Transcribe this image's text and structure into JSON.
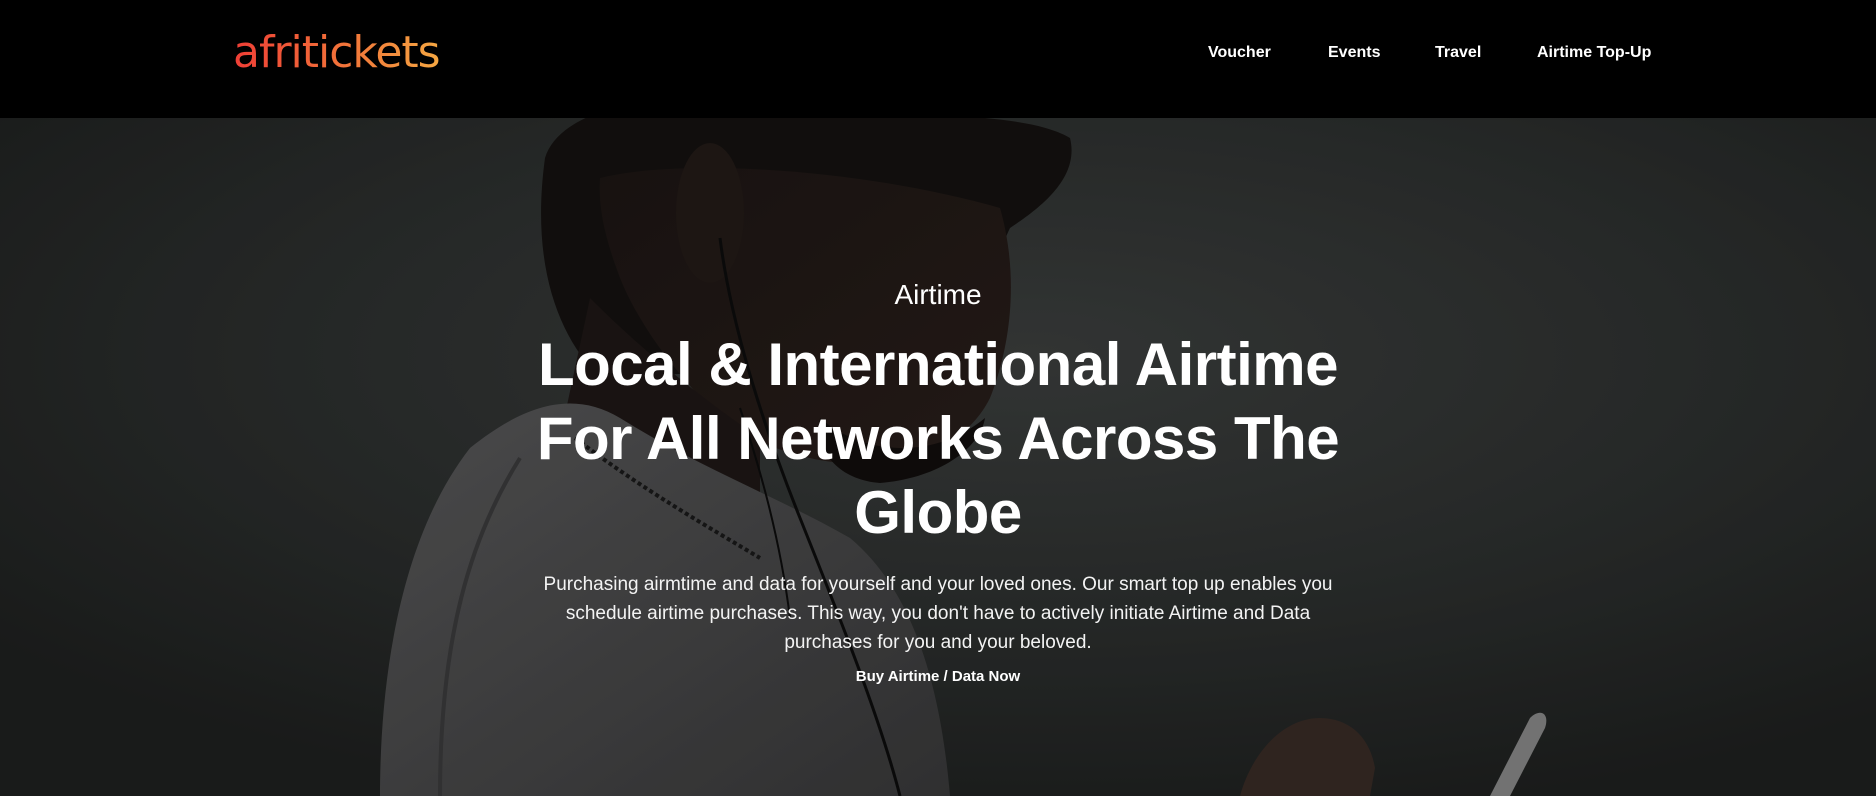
{
  "header": {
    "logo_text": "afritickets",
    "nav": [
      {
        "label": "Voucher"
      },
      {
        "label": "Events"
      },
      {
        "label": "Travel"
      },
      {
        "label": "Airtime Top-Up"
      }
    ]
  },
  "hero": {
    "eyebrow": "Airtime",
    "headline": "Local & International Airtime For All Networks Across The Globe",
    "description": "Purchasing airmtime and data for yourself and your loved ones. Our smart top up enables you schedule airtime purchases. This way, you don't have to actively initiate Airtime and Data purchases for you and your beloved.",
    "cta_label": "Buy Airtime / Data Now"
  },
  "colors": {
    "navbar_bg": "#000000",
    "logo_gradient_start": "#ef3e36",
    "logo_gradient_end": "#f5a742",
    "hero_text": "#ffffff"
  }
}
